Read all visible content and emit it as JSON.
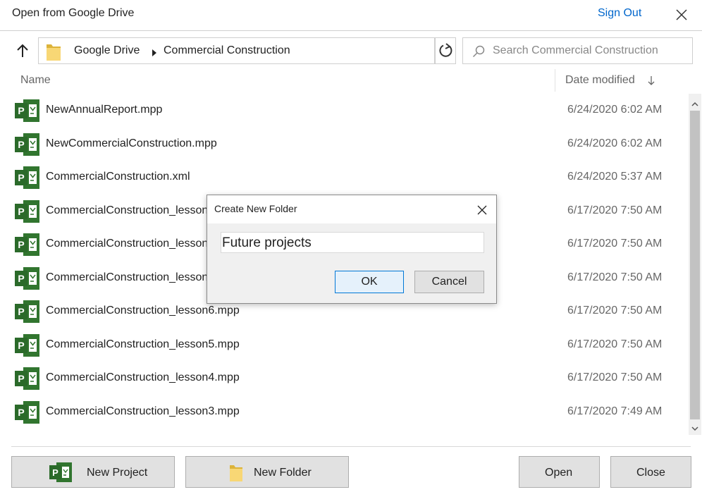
{
  "window": {
    "title": "Open from Google Drive",
    "sign_out": "Sign Out"
  },
  "nav": {
    "breadcrumb": [
      "Google Drive",
      "Commercial Construction"
    ],
    "search_placeholder": "Search Commercial Construction"
  },
  "columns": {
    "name": "Name",
    "date_modified": "Date modified",
    "sort": "descending"
  },
  "files": [
    {
      "name": "NewAnnualReport.mpp",
      "date": "6/24/2020 6:02 AM",
      "icon": "project-file-icon"
    },
    {
      "name": "NewCommercialConstruction.mpp",
      "date": "6/24/2020 6:02 AM",
      "icon": "project-file-icon"
    },
    {
      "name": "CommercialConstruction.xml",
      "date": "6/24/2020 5:37 AM",
      "icon": "project-file-icon"
    },
    {
      "name": "CommercialConstruction_lesson",
      "date": "6/17/2020 7:50 AM",
      "icon": "project-file-icon"
    },
    {
      "name": "CommercialConstruction_lesson",
      "date": "6/17/2020 7:50 AM",
      "icon": "project-file-icon"
    },
    {
      "name": "CommercialConstruction_lesson",
      "date": "6/17/2020 7:50 AM",
      "icon": "project-file-icon"
    },
    {
      "name": "CommercialConstruction_lesson6.mpp",
      "date": "6/17/2020 7:50 AM",
      "icon": "project-file-icon"
    },
    {
      "name": "CommercialConstruction_lesson5.mpp",
      "date": "6/17/2020 7:50 AM",
      "icon": "project-file-icon"
    },
    {
      "name": "CommercialConstruction_lesson4.mpp",
      "date": "6/17/2020 7:50 AM",
      "icon": "project-file-icon"
    },
    {
      "name": "CommercialConstruction_lesson3.mpp",
      "date": "6/17/2020 7:49 AM",
      "icon": "project-file-icon"
    }
  ],
  "footer": {
    "new_project": "New Project",
    "new_folder": "New Folder",
    "open": "Open",
    "close": "Close"
  },
  "dialog": {
    "title": "Create New Folder",
    "input_value": "Future projects",
    "ok": "OK",
    "cancel": "Cancel"
  },
  "colors": {
    "link": "#0066cc",
    "project_green": "#31752f",
    "folder_yellow": "#f8d775",
    "ok_border": "#0078d7"
  }
}
